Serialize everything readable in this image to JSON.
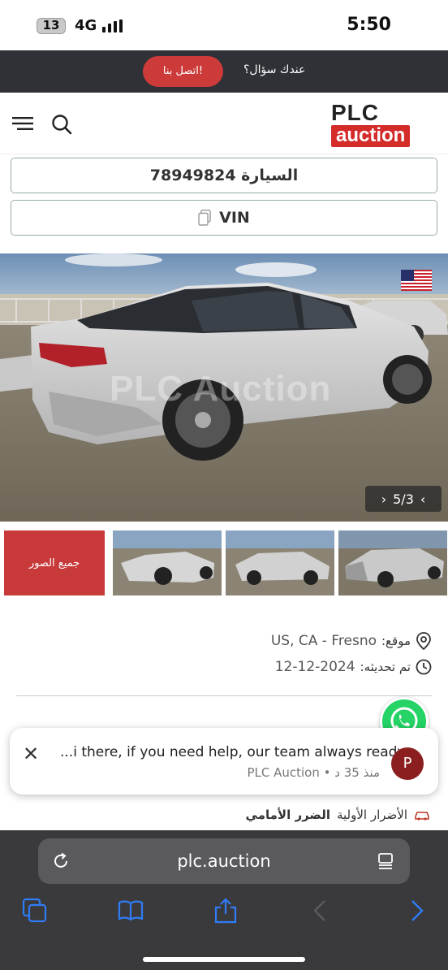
{
  "status_bar": {
    "battery": "13",
    "network": "4G",
    "time": "5:50"
  },
  "topbar": {
    "question_text": "عندك سؤال؟",
    "contact_button": "اتصل بنا!"
  },
  "header": {
    "logo_top": "PLC",
    "logo_bottom": "auction"
  },
  "lot_field": {
    "text": "السيارة 78949824"
  },
  "vin_field": {
    "text": "VIN"
  },
  "gallery": {
    "counter": "5/3",
    "watermark": "PLC Auction",
    "all_photos_label": "جميع الصور"
  },
  "info": {
    "location_label": "موقع:",
    "location_value": "US, CA - Fresno",
    "updated_label": "تم تحديثه:",
    "updated_value": "12-12-2024",
    "damage_label": "الأضرار الأولية",
    "damage_value": "الضرر الأمامي"
  },
  "chat_notification": {
    "message": "...i there, if you need help, our team always ready",
    "sender": "PLC Auction",
    "time_ago": "منذ 35 د",
    "avatar_letter": "P"
  },
  "browser": {
    "url": "plc.auction"
  },
  "colors": {
    "brand_red": "#d42b2b",
    "button_red": "#cc3a3a",
    "topbar": "#2f3136",
    "ios_blue": "#2f7cf6",
    "whatsapp_green": "#25d366"
  }
}
